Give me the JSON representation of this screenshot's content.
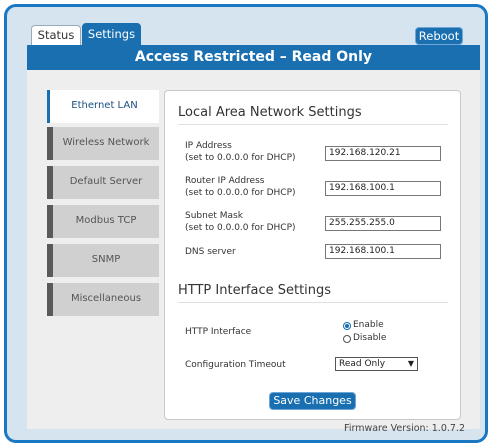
{
  "tabs": [
    {
      "label": "Status",
      "active": false
    },
    {
      "label": "Settings",
      "active": true
    }
  ],
  "reboot_label": "Reboot",
  "banner": "Access Restricted – Read Only",
  "sidebar": {
    "items": [
      {
        "label": "Ethernet LAN",
        "active": true
      },
      {
        "label": "Wireless Network",
        "active": false
      },
      {
        "label": "Default Server",
        "active": false
      },
      {
        "label": "Modbus TCP",
        "active": false
      },
      {
        "label": "SNMP",
        "active": false
      },
      {
        "label": "Miscellaneous",
        "active": false
      }
    ]
  },
  "lan": {
    "title": "Local Area Network Settings",
    "fields": [
      {
        "label": "IP Address",
        "hint": "(set to 0.0.0.0 for DHCP)",
        "value": "192.168.120.21"
      },
      {
        "label": "Router IP Address",
        "hint": "(set to 0.0.0.0 for DHCP)",
        "value": "192.168.100.1"
      },
      {
        "label": "Subnet Mask",
        "hint": "(set to 0.0.0.0 for DHCP)",
        "value": "255.255.255.0"
      },
      {
        "label": "DNS server",
        "hint": "",
        "value": "192.168.100.1"
      }
    ]
  },
  "http": {
    "title": "HTTP Interface Settings",
    "interface_label": "HTTP Interface",
    "options": [
      {
        "label": "Enable",
        "selected": true
      },
      {
        "label": "Disable",
        "selected": false
      }
    ],
    "timeout_label": "Configuration Timeout",
    "timeout_value": "Read Only"
  },
  "save_label": "Save Changes",
  "firmware": "Firmware Version: 1.0.7.2",
  "colors": {
    "accent": "#1a6fb0",
    "frame": "#1a78c2",
    "background": "#d6e4f0"
  }
}
